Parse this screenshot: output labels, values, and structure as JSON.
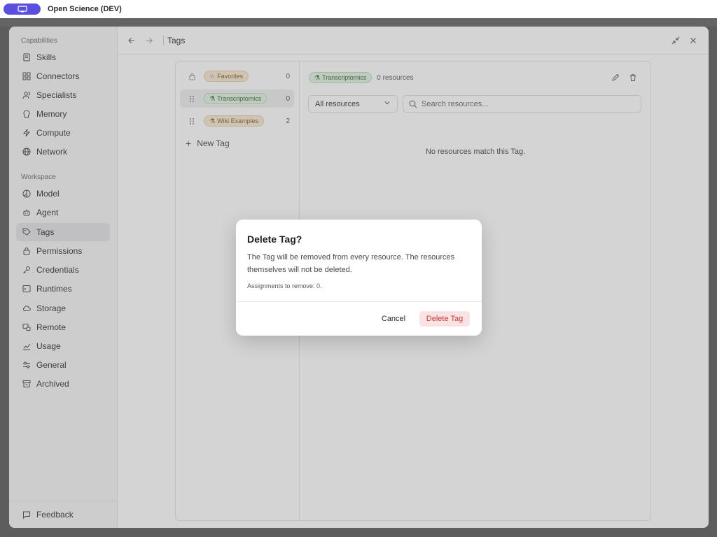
{
  "app": {
    "title": "Open Science (DEV)"
  },
  "sidebar": {
    "capabilities_label": "Capabilities",
    "capabilities": [
      {
        "label": "Skills",
        "icon": "skills-icon"
      },
      {
        "label": "Connectors",
        "icon": "connectors-icon"
      },
      {
        "label": "Specialists",
        "icon": "specialists-icon"
      },
      {
        "label": "Memory",
        "icon": "memory-icon"
      },
      {
        "label": "Compute",
        "icon": "compute-icon"
      },
      {
        "label": "Network",
        "icon": "globe-icon"
      }
    ],
    "workspace_label": "Workspace",
    "workspace": [
      {
        "label": "Model",
        "icon": "model-icon"
      },
      {
        "label": "Agent",
        "icon": "agent-icon"
      },
      {
        "label": "Tags",
        "icon": "tag-icon",
        "active": true
      },
      {
        "label": "Permissions",
        "icon": "lock-icon"
      },
      {
        "label": "Credentials",
        "icon": "key-icon"
      },
      {
        "label": "Runtimes",
        "icon": "terminal-icon"
      },
      {
        "label": "Storage",
        "icon": "cloud-icon"
      },
      {
        "label": "Remote",
        "icon": "remote-icon"
      },
      {
        "label": "Usage",
        "icon": "chart-icon"
      },
      {
        "label": "General",
        "icon": "sliders-icon"
      },
      {
        "label": "Archived",
        "icon": "archive-icon"
      }
    ],
    "feedback_label": "Feedback"
  },
  "header": {
    "title": "Tags"
  },
  "tags": [
    {
      "label": "Favorites",
      "count": "0",
      "style": "fav",
      "locked": true
    },
    {
      "label": "Transcriptomics",
      "count": "0",
      "style": "tx",
      "selected": true
    },
    {
      "label": "Wiki Examples",
      "count": "2",
      "style": "wiki"
    }
  ],
  "new_tag_label": "New Tag",
  "resources": {
    "tag_label": "Transcriptomics",
    "count_text": "0 resources",
    "filter_value": "All resources",
    "search_placeholder": "Search resources...",
    "empty_message": "No resources match this Tag."
  },
  "modal": {
    "title": "Delete Tag?",
    "body": "The Tag will be removed from every resource. The resources themselves will not be deleted.",
    "note": "Assignments to remove: 0.",
    "cancel_label": "Cancel",
    "delete_label": "Delete Tag",
    "danger_color": "#c53a3a"
  }
}
